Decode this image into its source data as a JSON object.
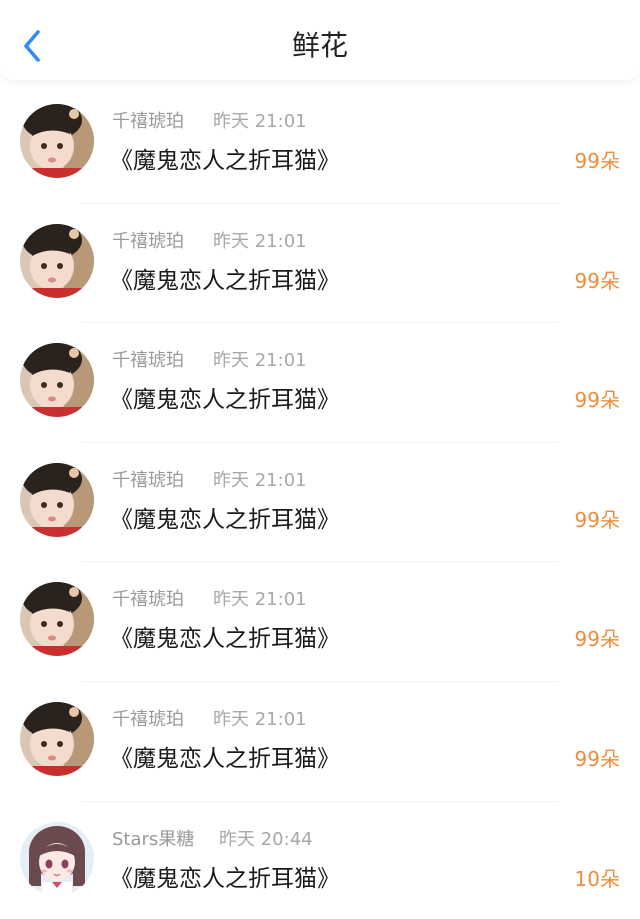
{
  "header": {
    "title": "鲜花",
    "back_icon": "chevron-left-icon",
    "accent": "#2f8cf6"
  },
  "amount_color": "#ee8d3c",
  "rows": [
    {
      "name": "千禧琥珀",
      "time": "昨天 21:01",
      "book": "《魔鬼恋人之折耳猫》",
      "amount": "99朵",
      "avatar": "child-photo-avatar"
    },
    {
      "name": "千禧琥珀",
      "time": "昨天 21:01",
      "book": "《魔鬼恋人之折耳猫》",
      "amount": "99朵",
      "avatar": "child-photo-avatar"
    },
    {
      "name": "千禧琥珀",
      "time": "昨天 21:01",
      "book": "《魔鬼恋人之折耳猫》",
      "amount": "99朵",
      "avatar": "child-photo-avatar"
    },
    {
      "name": "千禧琥珀",
      "time": "昨天 21:01",
      "book": "《魔鬼恋人之折耳猫》",
      "amount": "99朵",
      "avatar": "child-photo-avatar"
    },
    {
      "name": "千禧琥珀",
      "time": "昨天 21:01",
      "book": "《魔鬼恋人之折耳猫》",
      "amount": "99朵",
      "avatar": "child-photo-avatar"
    },
    {
      "name": "千禧琥珀",
      "time": "昨天 21:01",
      "book": "《魔鬼恋人之折耳猫》",
      "amount": "99朵",
      "avatar": "child-photo-avatar"
    },
    {
      "name": "Stars果糖",
      "time": "昨天 20:44",
      "book": "《魔鬼恋人之折耳猫》",
      "amount": "10朵",
      "avatar": "anime-girl-avatar"
    }
  ]
}
